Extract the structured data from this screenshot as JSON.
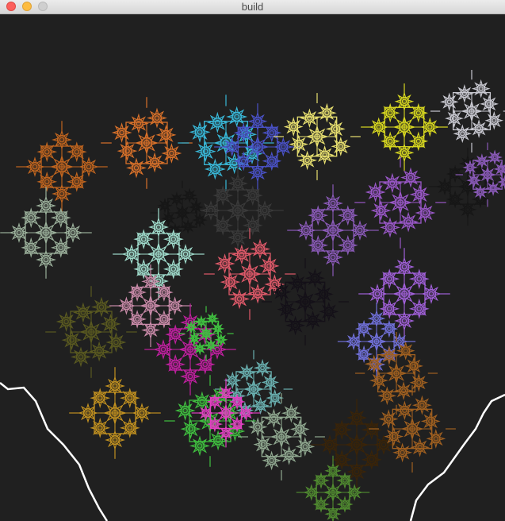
{
  "window": {
    "title": "build",
    "background": "#202020"
  },
  "scene": {
    "boundary_color": "#ffffff",
    "flower_colors": [
      "#c0651f",
      "#d8712a",
      "#9aaf9a",
      "#39b8d8",
      "#4a52c8",
      "#e8e070",
      "#d8d820",
      "#c8c8d0",
      "#161616",
      "#9a58c8",
      "#8a5ab8",
      "#3a3a3a",
      "#a0dccc",
      "#e05a6a",
      "#c88aa8",
      "#141018",
      "#a060d8",
      "#5a5a20",
      "#c020a0",
      "#6ab0b0",
      "#c09020",
      "#40c040",
      "#e040c0",
      "#90a890",
      "#a06020",
      "#3a2408",
      "#508a30",
      "#7070d8"
    ]
  }
}
